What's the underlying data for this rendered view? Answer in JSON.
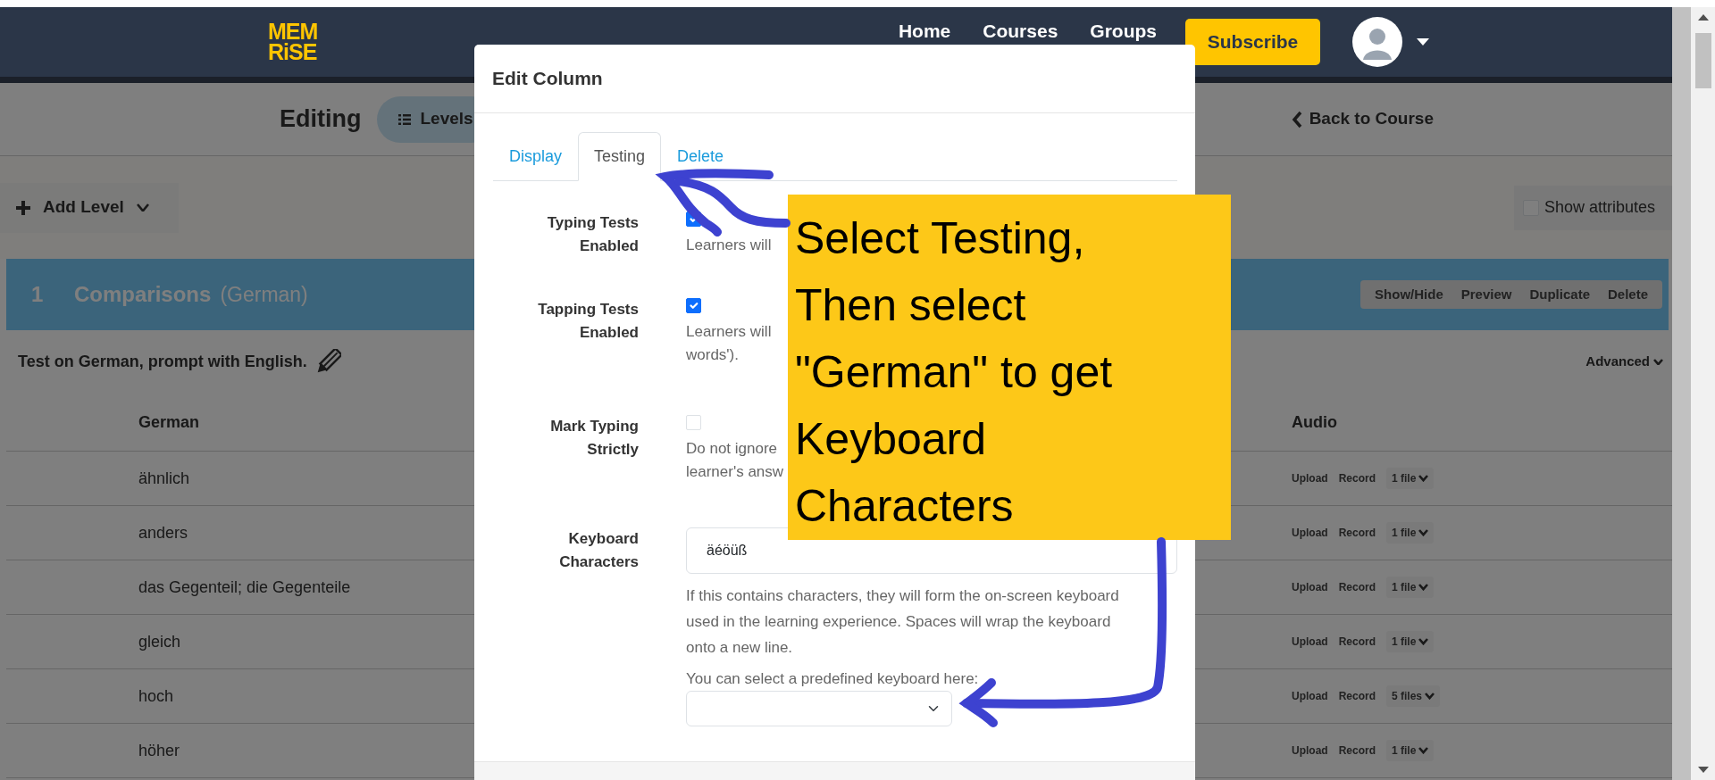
{
  "header": {
    "logo_lines": [
      "MEM",
      "RiSE"
    ],
    "nav": [
      "Home",
      "Courses",
      "Groups"
    ],
    "subscribe": "Subscribe"
  },
  "editing_bar": {
    "title": "Editing",
    "levels_tab": "Levels",
    "back_link": "Back to Course"
  },
  "toolbar": {
    "add_level": "Add Level",
    "show_attributes": {
      "label": "Show attributes",
      "checked": false
    }
  },
  "level": {
    "number": "1",
    "name": "Comparisons",
    "language": "(German)",
    "actions": [
      "Show/Hide",
      "Preview",
      "Duplicate",
      "Delete"
    ],
    "test_info": "Test on German, prompt with English.",
    "advanced": "Advanced"
  },
  "table": {
    "columns": [
      "German",
      "Audio"
    ],
    "rows": [
      {
        "word": "ähnlich",
        "upload": "Upload",
        "record": "Record",
        "files": "1 file"
      },
      {
        "word": "anders",
        "upload": "Upload",
        "record": "Record",
        "files": "1 file"
      },
      {
        "word": "das Gegenteil; die Gegenteile",
        "upload": "Upload",
        "record": "Record",
        "files": "1 file"
      },
      {
        "word": "gleich",
        "upload": "Upload",
        "record": "Record",
        "files": "1 file"
      },
      {
        "word": "hoch",
        "upload": "Upload",
        "record": "Record",
        "files": "5 files"
      },
      {
        "word": "höher",
        "upload": "Upload",
        "record": "Record",
        "files": "1 file"
      }
    ]
  },
  "modal": {
    "title": "Edit Column",
    "tabs": [
      {
        "label": "Display",
        "selected": false
      },
      {
        "label": "Testing",
        "selected": true
      },
      {
        "label": "Delete",
        "selected": false
      }
    ],
    "fields": [
      {
        "kind": "checkbox",
        "label": "Typing Tests Enabled",
        "checked": true,
        "help": [
          "Learners will"
        ]
      },
      {
        "kind": "checkbox",
        "label": "Tapping Tests Enabled",
        "checked": true,
        "help": [
          "Learners will",
          "words')."
        ]
      },
      {
        "kind": "checkbox",
        "label": "Mark Typing Strictly",
        "checked": false,
        "help": [
          "Do not ignore",
          "learner's answ"
        ]
      },
      {
        "kind": "keyboard",
        "label": "Keyboard Characters",
        "value": "äéöüß",
        "help_text": "If this contains characters, they will form the on-screen keyboard used in the learning experience. Spaces will wrap the keyboard onto a new line.",
        "select_label": "You can select a predefined keyboard here:"
      }
    ]
  },
  "annotation": {
    "lines": [
      "Select Testing,",
      "Then select",
      "\"German\" to get",
      "Keyboard",
      "Characters"
    ]
  }
}
